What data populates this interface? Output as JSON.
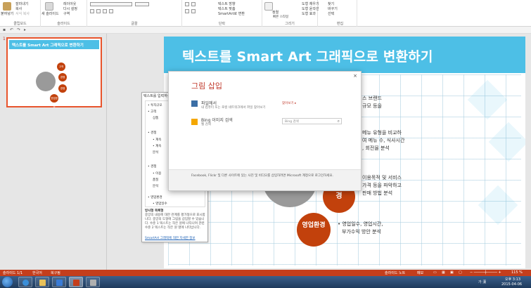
{
  "ribbon": {
    "paste_label": "붙여넣기",
    "cut_label": "잘라내기",
    "copy_label": "복사",
    "format_painter_label": "서식 복사",
    "clipboard_group": "클립보드",
    "new_slide_label": "새 슬라이드",
    "layout_label": "레이아웃",
    "reset_label": "다시 설정",
    "section_label": "구역",
    "slides_group": "슬라이드",
    "font_group": "글꼴",
    "text_direction_label": "텍스트 방향",
    "text_align_label": "텍스트 맞춤",
    "smartart_label": "SmartArt로 변환",
    "paragraph_group": "단락",
    "arrange_label": "정렬",
    "quick_styles_label": "빠른 스타일",
    "shape_fill_label": "도형 채우기",
    "shape_outline_label": "도형 윤곽선",
    "shape_effects_label": "도형 효과",
    "drawing_group": "그리기",
    "find_label": "찾기",
    "replace_label": "바꾸기",
    "select_label": "선택",
    "editing_group": "편집"
  },
  "slides": [
    {
      "number": "1",
      "title": "텍스트를 Smart Art 그래픽으로 변환하기",
      "circles": [
        "고객",
        "경쟁",
        "경쟁",
        "영업환경"
      ]
    }
  ],
  "slide": {
    "title": "텍스트를 Smart Art 그래픽으로 변환하기",
    "bullets": [
      [
        "스 브랜드",
        "규모 등을"
      ],
      [
        "메뉴 유형을 비교하",
        "여 메뉴 수, 식사시간",
        ", 회전율 분석"
      ],
      [
        "이용목적 및 서비스",
        "가격 등을 파악하고",
        "판매 방법 분석"
      ],
      [
        "• 영업일수, 영업시간,",
        "부가수익 방안 분석"
      ]
    ],
    "circle_labels": [
      "경",
      "영업환경"
    ]
  },
  "text_pane": {
    "title": "텍스트를 입력하십시오",
    "close": "×",
    "items": [
      "• 투자규모",
      "• 고객",
      "상품",
      "• 경쟁",
      "• 계속",
      "• 계속",
      "분석",
      "• 경쟁",
      "• 이용",
      "품질",
      "분석",
      "• 영업환경",
      "• 영업일수"
    ],
    "footer_title": "방사형 목록형",
    "footer_text": "중앙의 내용에 대한 관계를 평가형으로 표시합니다. 중앙의 도형에 그림을 삽입할 수 있습니다. 수준 1 텍스트는 작은 원에 나타나며 관련 수준 2 텍스트는 작은 원 옆에 나타납니다.",
    "link": "SmartArt 그래픽에 대한 자세한 정보"
  },
  "dialog": {
    "title": "그림 삽입",
    "close": "×",
    "file_title": "파일에서",
    "file_desc": "내 컴퓨터 또는 로컬 네트워크에서 파일 찾아보기",
    "browse": "찾아보기 ▸",
    "bing_title": "Bing 이미지 검색",
    "bing_desc": "웹 검색",
    "search_placeholder": "Bing 검색",
    "footer": "Facebook, Flickr 및 다른 사이트에 있는 사진 및 비디오를 삽입하려면 Microsoft 계정으로 로그인하세요."
  },
  "statusbar": {
    "slide": "슬라이드 1/1",
    "language": "한국어",
    "theme": "복구됨",
    "notes": "슬라이드 노트",
    "comments": "메모",
    "zoom": "115 %"
  },
  "taskbar": {
    "ime": "가 漢",
    "time": "오후 3:13",
    "date": "2015-04-06"
  },
  "colors": {
    "accent": "#c43e1c",
    "header_blue": "#4dbfe6",
    "circle_orange": "#c2410c",
    "circle_gray": "#9a9a9a"
  }
}
